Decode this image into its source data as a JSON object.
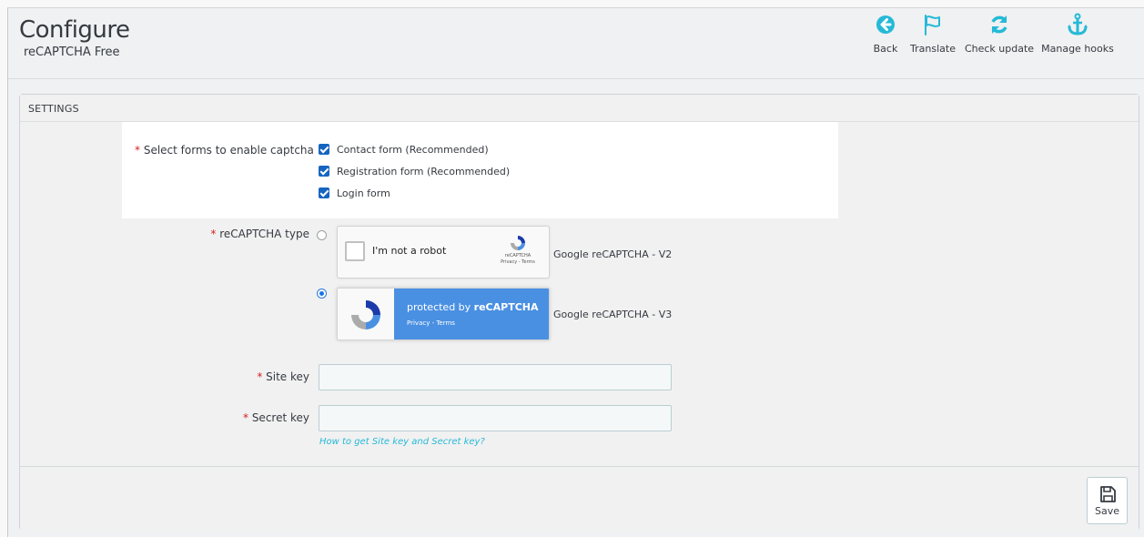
{
  "header": {
    "title": "Configure",
    "subtitle": "reCAPTCHA Free"
  },
  "toolbar": {
    "back_label": "Back",
    "translate_label": "Translate",
    "check_update_label": "Check update",
    "manage_hooks_label": "Manage hooks"
  },
  "settings": {
    "heading": "SETTINGS",
    "forms": {
      "label": "Select forms to enable captcha",
      "options": [
        {
          "label": "Contact form (Recommended)",
          "checked": true
        },
        {
          "label": "Registration form (Recommended)",
          "checked": true
        },
        {
          "label": "Login form",
          "checked": true
        }
      ]
    },
    "recaptcha_type": {
      "label": "reCAPTCHA type",
      "selected": "v3",
      "v2": {
        "robot_text": "I'm not a robot",
        "brand": "reCAPTCHA",
        "links": "Privacy - Terms",
        "caption": "Google reCAPTCHA - V2"
      },
      "v3": {
        "protected_prefix": "protected by ",
        "brand": "reCAPTCHA",
        "links": "Privacy - Terms",
        "caption": "Google reCAPTCHA - V3"
      }
    },
    "site_key": {
      "label": "Site key",
      "value": ""
    },
    "secret_key": {
      "label": "Secret key",
      "value": ""
    },
    "help_link": "How to get Site key and Secret key?",
    "required_mark": "*"
  },
  "footer": {
    "save_label": "Save"
  },
  "colors": {
    "accent": "#25b9d7",
    "checkbox": "#1565c0",
    "required": "#d61f1f",
    "v3_badge": "#4a90e2"
  },
  "icons": {
    "back": "arrow-left-circle-icon",
    "translate": "flag-icon",
    "check_update": "refresh-icon",
    "manage_hooks": "anchor-icon",
    "save": "floppy-disk-icon"
  }
}
